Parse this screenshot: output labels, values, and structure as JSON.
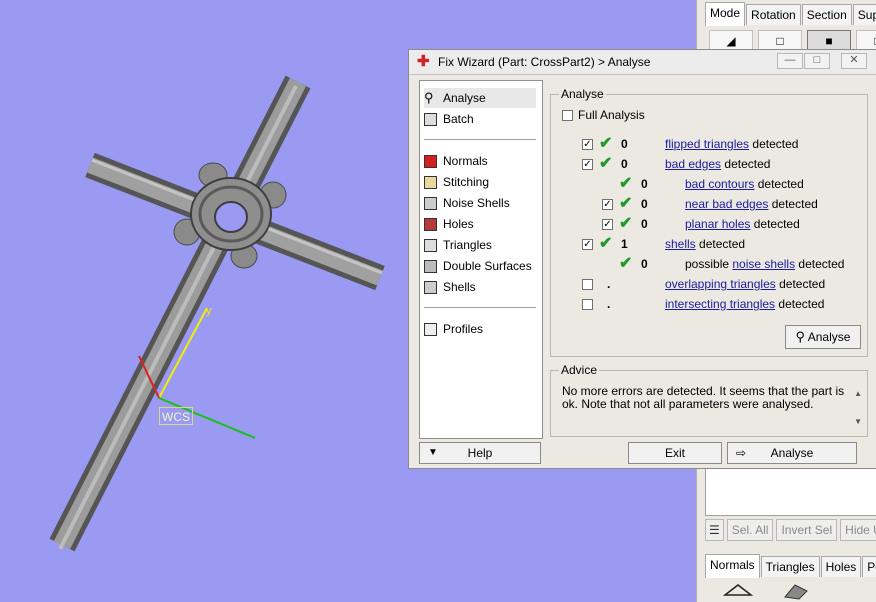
{
  "window_title": "Fix Wizard (Part: CrossPart2) > Analyse",
  "viewport": {
    "wcs_label": "WCS",
    "axis_y_label": "y"
  },
  "right_panel": {
    "tabs": [
      "Mode",
      "Rotation",
      "Section",
      "Supp"
    ],
    "toolbar": {
      "sel_all": "Sel. All",
      "invert_sel": "Invert Sel",
      "hide_un": "Hide Un"
    },
    "bottom_tabs": [
      "Normals",
      "Triangles",
      "Holes",
      "Poir"
    ]
  },
  "nav": {
    "items": [
      {
        "label": "Analyse"
      },
      {
        "label": "Batch"
      },
      {
        "label": "Normals"
      },
      {
        "label": "Stitching"
      },
      {
        "label": "Noise Shells"
      },
      {
        "label": "Holes"
      },
      {
        "label": "Triangles"
      },
      {
        "label": "Double Surfaces"
      },
      {
        "label": "Shells"
      },
      {
        "label": "Profiles"
      }
    ]
  },
  "analyse": {
    "group_title": "Analyse",
    "full_analysis_label": "Full Analysis",
    "rows": [
      {
        "count": "0",
        "link": "flipped triangles",
        "suffix": "detected"
      },
      {
        "count": "0",
        "link": "bad edges",
        "suffix": "detected"
      },
      {
        "count": "0",
        "link": "bad contours",
        "suffix": "detected"
      },
      {
        "count": "0",
        "link": "near bad edges",
        "suffix": "detected"
      },
      {
        "count": "0",
        "link": "planar holes",
        "suffix": "detected"
      },
      {
        "count": "1",
        "link": "shells",
        "suffix": "detected"
      },
      {
        "count": "0",
        "prefix": "possible",
        "link": "noise shells",
        "suffix": "detected"
      },
      {
        "count": ".",
        "link": "overlapping triangles",
        "suffix": "detected"
      },
      {
        "count": ".",
        "link": "intersecting triangles",
        "suffix": "detected"
      }
    ],
    "analyse_button": "Analyse"
  },
  "advice": {
    "title": "Advice",
    "text": "No more errors are detected. It seems that the part is ok. Note that not all parameters were analysed."
  },
  "bottom": {
    "help": "Help",
    "exit": "Exit",
    "analyse": "Analyse"
  },
  "colors": {
    "background": "#9a9af2",
    "link": "#1b1b9b",
    "tick": "#1f9a2b",
    "title_icon": "#d2232a"
  }
}
